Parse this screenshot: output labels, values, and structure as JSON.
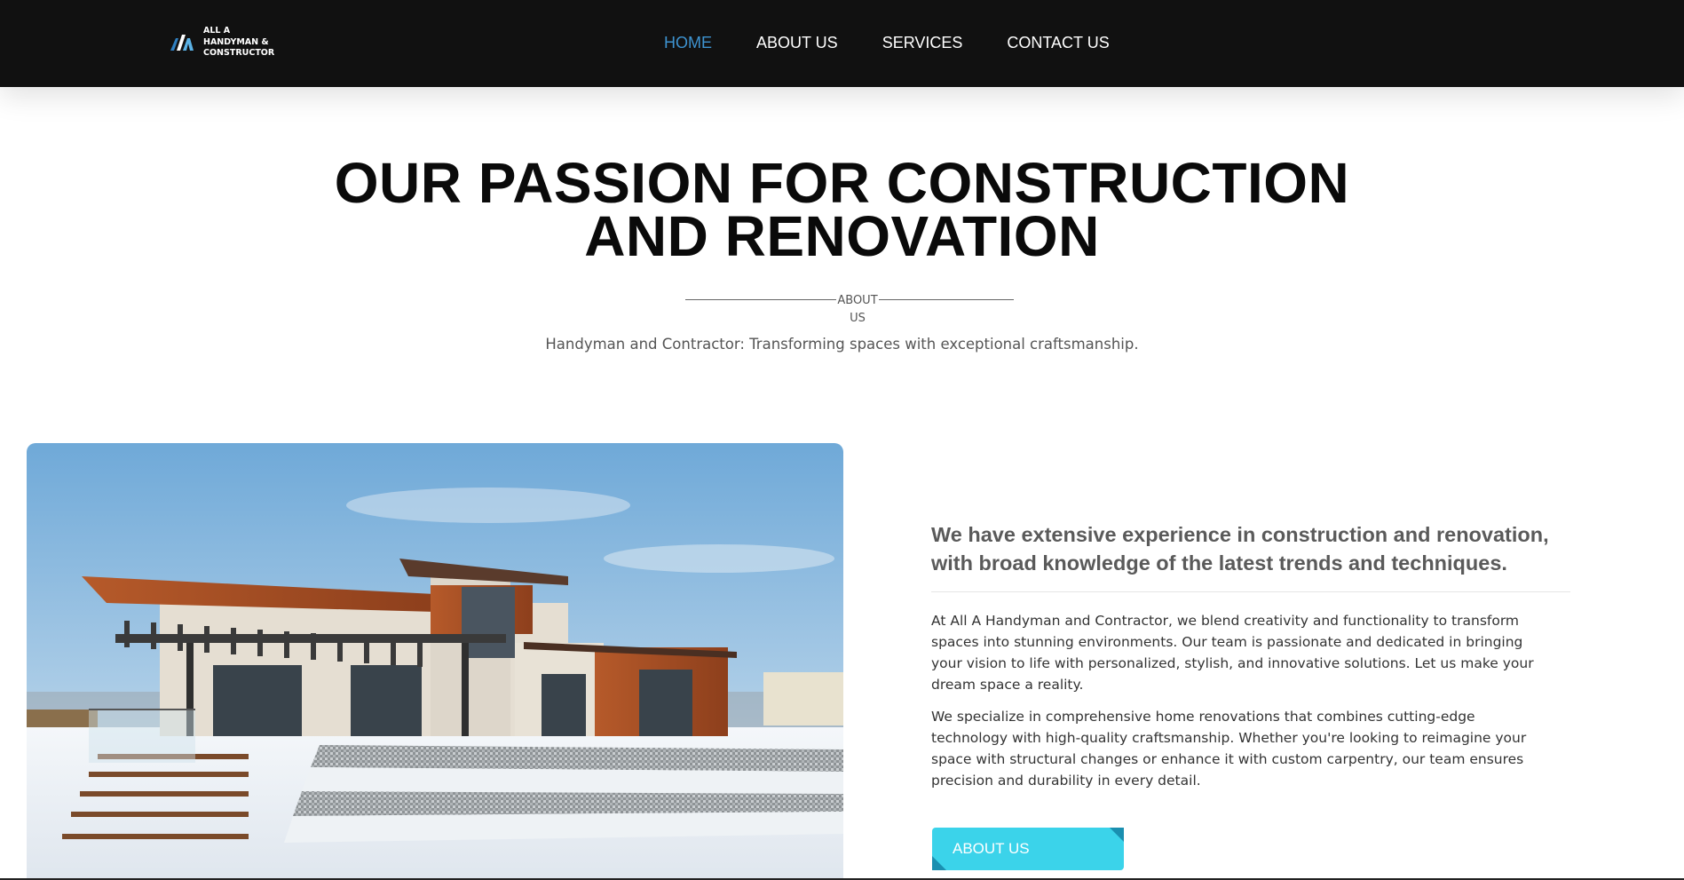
{
  "header": {
    "logo": {
      "lines": [
        "ALL A",
        "HANDYMAN &",
        "CONSTRUCTOR"
      ],
      "icon": "logo-mark-icon"
    },
    "nav": [
      {
        "label": "HOME",
        "active": true
      },
      {
        "label": "ABOUT US",
        "active": false
      },
      {
        "label": "SERVICES",
        "active": false
      },
      {
        "label": "CONTACT US",
        "active": false
      }
    ]
  },
  "hero": {
    "title_line1": "OUR PASSION FOR CONSTRUCTION",
    "title_line2": "AND RENOVATION",
    "section_label_line1": "ABOUT",
    "section_label_line2": "US",
    "subtitle": "Handyman and Contractor: Transforming spaces with exceptional craftsmanship."
  },
  "about": {
    "heading": "We have extensive experience in construction and renovation, with broad knowledge of the latest trends and techniques.",
    "paragraphs": [
      "At All A Handyman and Contractor, we blend creativity and functionality to transform spaces into stunning environments. Our team is passionate and dedicated in bringing your vision to life with personalized, stylish, and innovative solutions. Let us make your dream space a reality.",
      "We specialize in comprehensive home renovations that combines cutting-edge technology with high-quality craftsmanship. Whether you're looking to reimagine your space with structural changes or enhance it with custom carpentry, our team ensures precision and durability in every detail."
    ],
    "button_label": "ABOUT US"
  },
  "colors": {
    "header_bg": "#111111",
    "nav_active": "#3e93d0",
    "cta": "#3bd3ea",
    "cta_corner": "#1a8fb0"
  }
}
